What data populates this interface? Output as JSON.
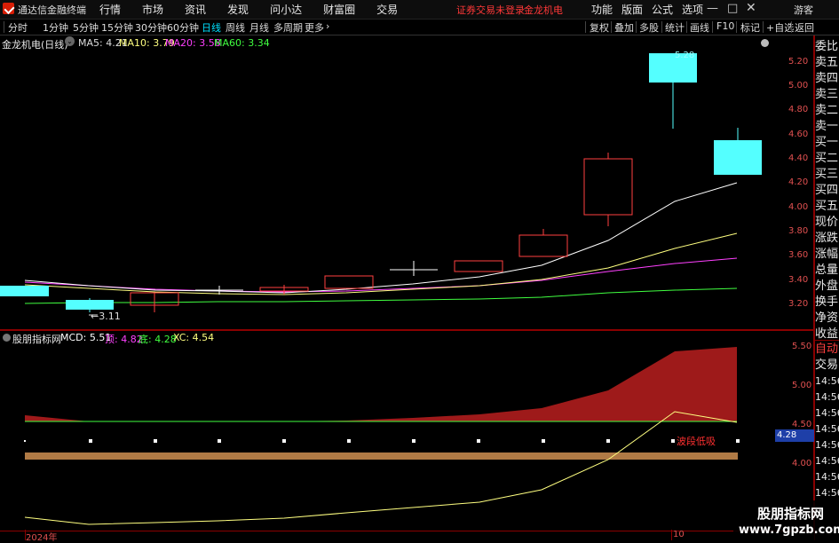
{
  "app": {
    "title": "通达信金融终端",
    "warning": "证券交易未登录",
    "stock_name": "金龙机电",
    "guest_label": "游客"
  },
  "menu": {
    "items": [
      "行情",
      "市场",
      "资讯",
      "发现",
      "问小达",
      "财富圈",
      "交易"
    ]
  },
  "right_menu": {
    "items": [
      "功能",
      "版面",
      "公式",
      "选项"
    ]
  },
  "period_bar": {
    "periods": [
      "分时",
      "1分钟",
      "5分钟",
      "15分钟",
      "30分钟",
      "60分钟",
      "日线",
      "周线",
      "月线",
      "多周期",
      "更多"
    ],
    "active": "日线",
    "tools": [
      "复权",
      "叠加",
      "多股",
      "统计",
      "画线",
      "F10",
      "标记",
      "+自选",
      "返回"
    ]
  },
  "main_chart": {
    "header": "金龙机电(日线)",
    "ma": [
      {
        "label": "MA5: 4.21",
        "color": "#ffffff"
      },
      {
        "label": "MA10: 3.79",
        "color": "#ffff80"
      },
      {
        "label": "MA20: 3.58",
        "color": "#ff40ff"
      },
      {
        "label": "MA60: 3.34",
        "color": "#40ff40"
      }
    ],
    "y_ticks": [
      "5.20",
      "5.00",
      "4.80",
      "4.60",
      "4.40",
      "4.20",
      "4.00",
      "3.80",
      "3.60",
      "3.40",
      "3.20"
    ],
    "low_annotation": "3.11",
    "high_annotation": "5.28"
  },
  "sub_chart": {
    "header": "股朋指标网",
    "values": [
      {
        "label": "MCD: 5.51",
        "color": "#ffffff"
      },
      {
        "label": "顶: 4.82",
        "color": "#ff40ff"
      },
      {
        "label": "底: 4.28",
        "color": "#40ff40"
      },
      {
        "label": "XC: 4.54",
        "color": "#ffff80"
      }
    ],
    "y_ticks": [
      "5.50",
      "5.00",
      "4.50",
      "4.00"
    ],
    "badge": "4.28",
    "signal_text": "波段低吸"
  },
  "right_panel": {
    "labels": [
      "委比",
      "卖五",
      "卖四",
      "卖三",
      "卖二",
      "卖一",
      "买一",
      "买二",
      "买三",
      "买四",
      "买五",
      "现价",
      "涨跌",
      "涨幅",
      "总量",
      "外盘",
      "换手",
      "净资",
      "收益"
    ],
    "lower": [
      "自动",
      "交易",
      "14:56",
      "14:56",
      "14:56",
      "14:56",
      "14:56",
      "14:56",
      "14:56",
      "14:56"
    ]
  },
  "x_axis": {
    "labels": [
      "2024年",
      "10"
    ]
  },
  "watermark": {
    "line1": "股朋指标网",
    "line2": "www.7gpzb.com"
  }
}
